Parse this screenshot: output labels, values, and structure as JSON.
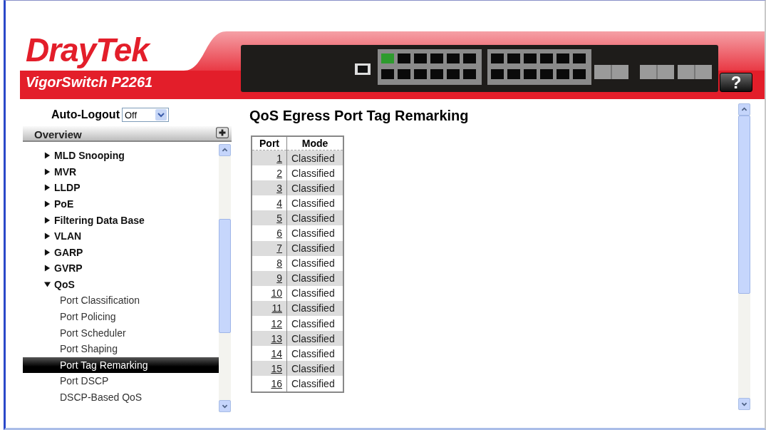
{
  "logo": {
    "brand": "DrayTek",
    "model": "VigorSwitch P2261"
  },
  "help_button": "?",
  "auto_logout": {
    "label": "Auto-Logout",
    "value": "Off"
  },
  "nav": {
    "title": "Overview",
    "items": [
      {
        "label": "MLD Snooping",
        "expanded": false
      },
      {
        "label": "MVR",
        "expanded": false
      },
      {
        "label": "LLDP",
        "expanded": false
      },
      {
        "label": "PoE",
        "expanded": false
      },
      {
        "label": "Filtering Data Base",
        "expanded": false
      },
      {
        "label": "VLAN",
        "expanded": false
      },
      {
        "label": "GARP",
        "expanded": false
      },
      {
        "label": "GVRP",
        "expanded": false
      },
      {
        "label": "QoS",
        "expanded": true,
        "children": [
          {
            "label": "Port Classification",
            "selected": false
          },
          {
            "label": "Port Policing",
            "selected": false
          },
          {
            "label": "Port Scheduler",
            "selected": false
          },
          {
            "label": "Port Shaping",
            "selected": false
          },
          {
            "label": "Port Tag Remarking",
            "selected": true
          },
          {
            "label": "Port DSCP",
            "selected": false
          },
          {
            "label": "DSCP-Based QoS",
            "selected": false
          }
        ]
      }
    ]
  },
  "page": {
    "title": "QoS Egress Port Tag Remarking",
    "table": {
      "columns": [
        "Port",
        "Mode"
      ],
      "rows": [
        {
          "port": "1",
          "mode": "Classified"
        },
        {
          "port": "2",
          "mode": "Classified"
        },
        {
          "port": "3",
          "mode": "Classified"
        },
        {
          "port": "4",
          "mode": "Classified"
        },
        {
          "port": "5",
          "mode": "Classified"
        },
        {
          "port": "6",
          "mode": "Classified"
        },
        {
          "port": "7",
          "mode": "Classified"
        },
        {
          "port": "8",
          "mode": "Classified"
        },
        {
          "port": "9",
          "mode": "Classified"
        },
        {
          "port": "10",
          "mode": "Classified"
        },
        {
          "port": "11",
          "mode": "Classified"
        },
        {
          "port": "12",
          "mode": "Classified"
        },
        {
          "port": "13",
          "mode": "Classified"
        },
        {
          "port": "14",
          "mode": "Classified"
        },
        {
          "port": "15",
          "mode": "Classified"
        },
        {
          "port": "16",
          "mode": "Classified"
        }
      ]
    }
  }
}
